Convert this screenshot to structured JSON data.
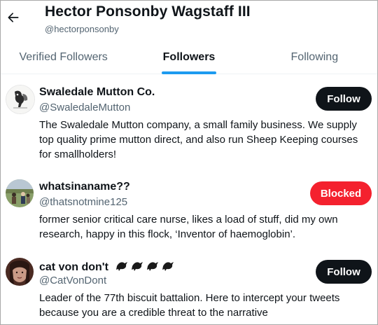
{
  "header": {
    "title": "Hector Ponsonby Wagstaff III",
    "handle": "@hectorponsonby"
  },
  "tabs": [
    {
      "label": "Verified Followers"
    },
    {
      "label": "Followers",
      "active": true
    },
    {
      "label": "Following"
    }
  ],
  "users": [
    {
      "name": "Swaledale Mutton Co.",
      "handle": "@SwaledaleMutton",
      "bio": "The Swaledale Mutton company, a small family business. We supply top quality prime mutton direct, and also run Sheep Keeping courses for smallholders!",
      "button": "Follow"
    },
    {
      "name": "whatsinaname??",
      "handle": "@thatsnotmine125",
      "bio": "former senior critical care nurse, likes a load of stuff, did my own research, happy in this flock, ‘Inventor of haemoglobin’.",
      "button": "Blocked"
    },
    {
      "name": "cat von don't",
      "handle": "@CatVonDont",
      "bio": "Leader of the 77th biscuit battalion. Here to intercept your tweets because you are a credible threat to the narrative",
      "button": "Follow",
      "name_icons": [
        "bird-icon",
        "bird-icon",
        "bird-icon",
        "bird-icon"
      ]
    }
  ],
  "colors": {
    "accent": "#1d9bf0",
    "blocked": "#f4212e",
    "follow_bg": "#0f1419",
    "muted": "#536471"
  }
}
